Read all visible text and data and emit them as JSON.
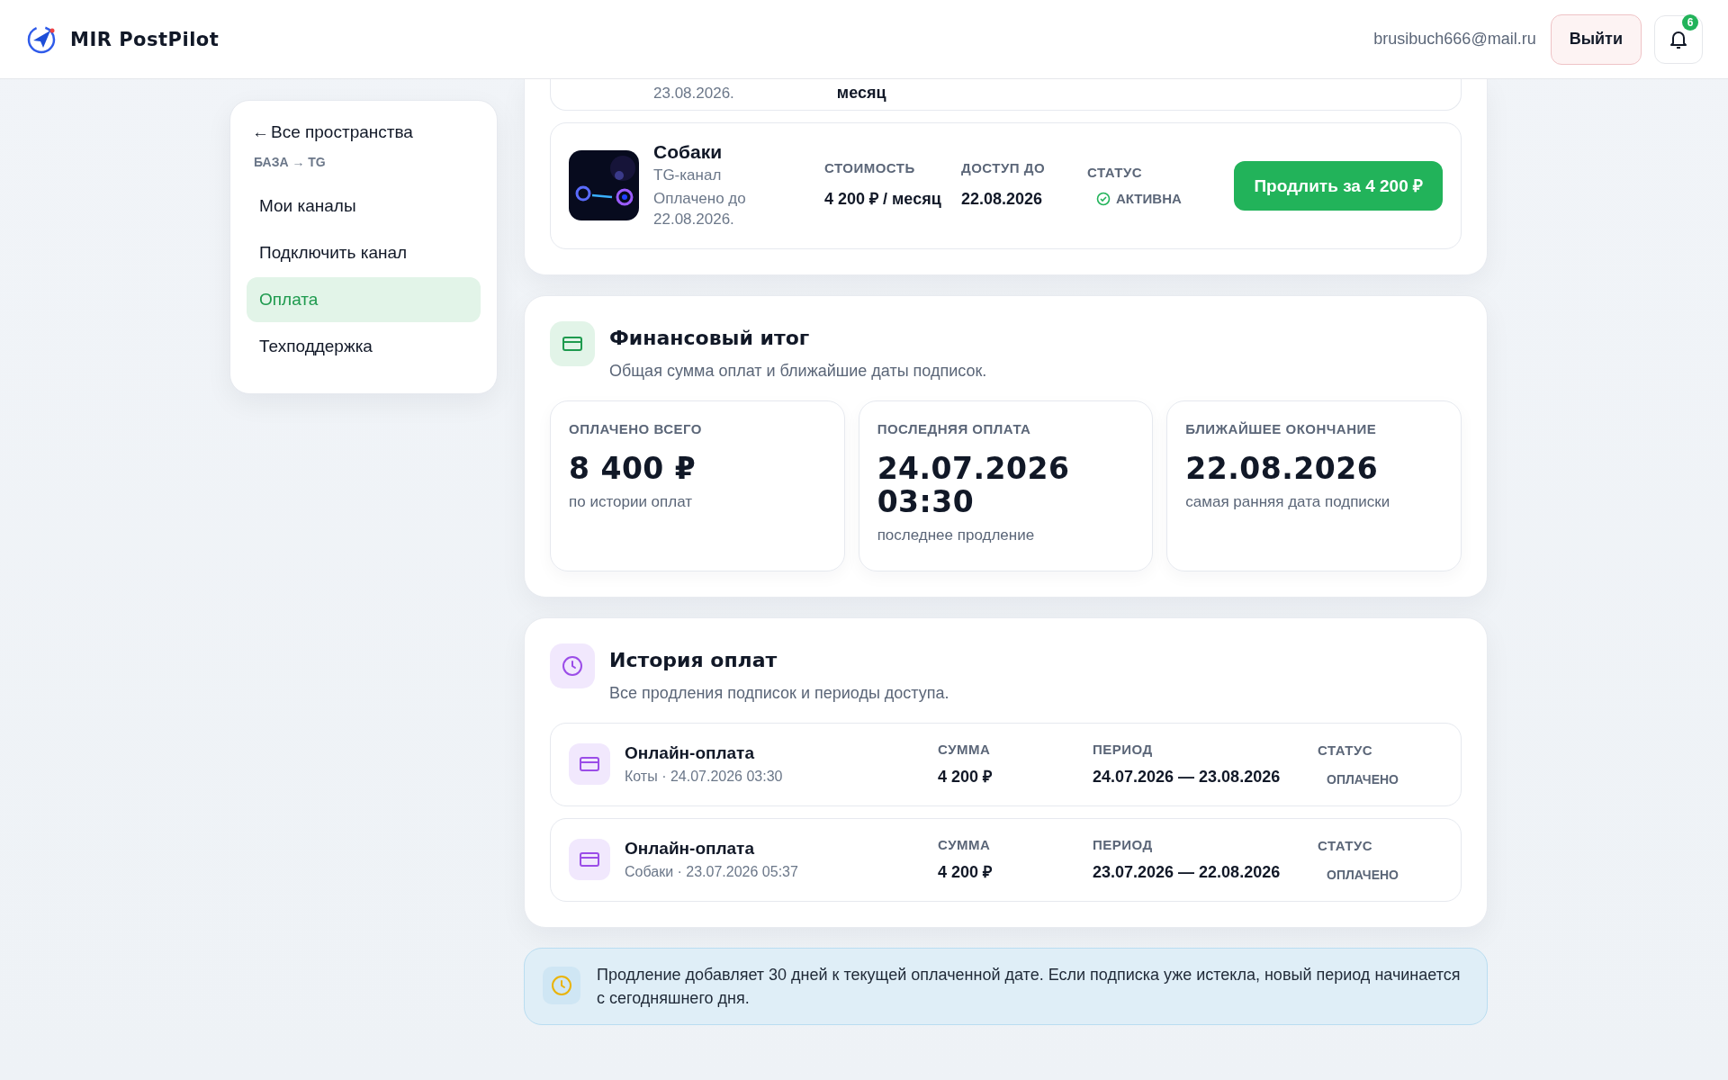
{
  "header": {
    "logo": "MIR PostPilot",
    "email": "brusibuch666@mail.ru",
    "logout": "Выйти",
    "notifications": "6"
  },
  "sidebar": {
    "back_arrow": "←",
    "back": "Все пространства",
    "breadcrumb": "БАЗА → TG",
    "items": [
      {
        "label": "Мои каналы",
        "selected": false
      },
      {
        "label": "Подключить канал",
        "selected": false
      },
      {
        "label": "Оплата",
        "selected": true
      },
      {
        "label": "Техподдержка",
        "selected": false
      }
    ]
  },
  "subscriptions": {
    "partial_row": {
      "paid_until": "23.08.2026.",
      "price": "месяц"
    },
    "rows": [
      {
        "name": "Собаки",
        "type": "TG-канал",
        "paid_until": "Оплачено до 22.08.2026.",
        "price_label": "СТОИМОСТЬ",
        "price": "4 200 ₽ / месяц",
        "access_label": "ДОСТУП ДО",
        "access": "22.08.2026",
        "status_label": "СТАТУС",
        "status": "АКТИВНА",
        "button": "Продлить за 4 200 ₽"
      }
    ]
  },
  "finance": {
    "title": "Финансовый итог",
    "subtitle": "Общая сумма оплат и ближайшие даты подписок.",
    "stats": [
      {
        "label": "ОПЛАЧЕНО ВСЕГО",
        "value": "8 400 ₽",
        "note": "по истории оплат"
      },
      {
        "label": "ПОСЛЕДНЯЯ ОПЛАТА",
        "value": "24.07.2026 03:30",
        "note": "последнее продление"
      },
      {
        "label": "БЛИЖАЙШЕЕ ОКОНЧАНИЕ",
        "value": "22.08.2026",
        "note": "самая ранняя дата подписки"
      }
    ]
  },
  "history": {
    "title": "История оплат",
    "subtitle": "Все продления подписок и периоды доступа.",
    "payments": [
      {
        "title": "Онлайн-оплата",
        "meta": "Коты · 24.07.2026 03:30",
        "amount_label": "СУММА",
        "amount": "4 200 ₽",
        "period_label": "ПЕРИОД",
        "period": "24.07.2026 — 23.08.2026",
        "status_label": "СТАТУС",
        "status": "ОПЛАЧЕНО"
      },
      {
        "title": "Онлайн-оплата",
        "meta": "Собаки · 23.07.2026 05:37",
        "amount_label": "СУММА",
        "amount": "4 200 ₽",
        "period_label": "ПЕРИОД",
        "period": "23.07.2026 — 22.08.2026",
        "status_label": "СТАТУС",
        "status": "ОПЛАЧЕНО"
      }
    ]
  },
  "note": "Продление добавляет 30 дней к текущей оплаченной дате. Если подписка уже истекла, новый период начинается с сегодняшнего дня."
}
